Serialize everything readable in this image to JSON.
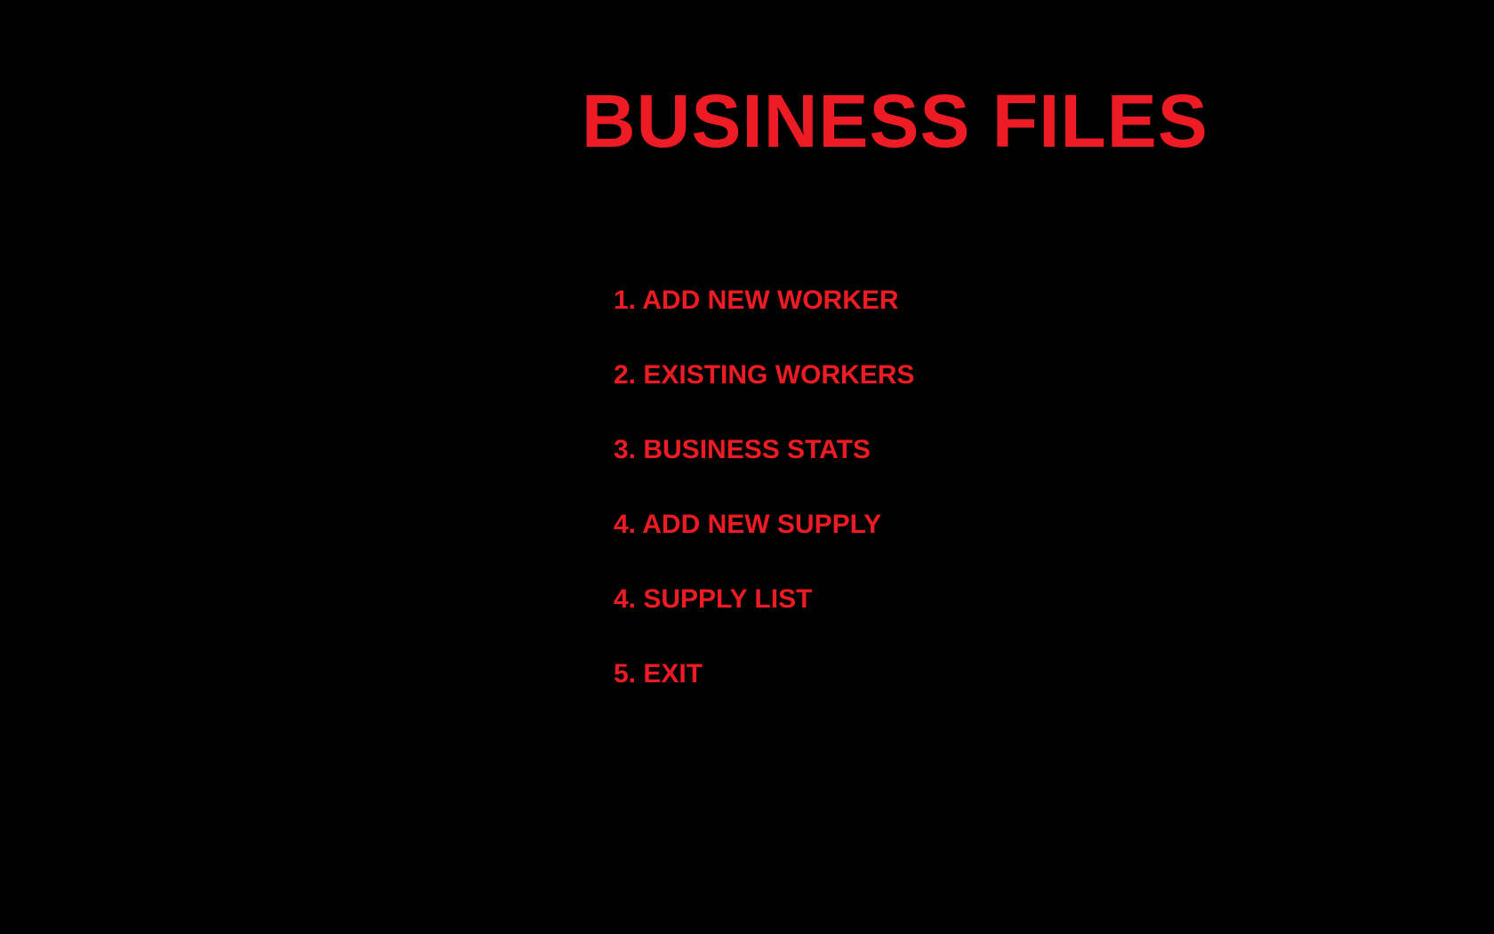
{
  "title": "BUSINESS FILES",
  "menu": {
    "items": [
      "1. ADD NEW WORKER",
      "2. EXISTING WORKERS",
      "3. BUSINESS STATS",
      "4. ADD NEW SUPPLY",
      "4. SUPPLY LIST",
      "5. EXIT"
    ]
  },
  "colors": {
    "background": "#000000",
    "text": "#ed1c24"
  }
}
